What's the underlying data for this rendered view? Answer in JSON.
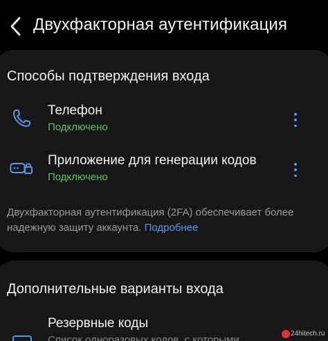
{
  "header": {
    "title": "Двухфакторная аутентификация",
    "back_icon": "chevron-left-icon"
  },
  "section1": {
    "title": "Способы подтверждения входа",
    "items": [
      {
        "icon": "phone-icon",
        "title": "Телефон",
        "status": "Подключено",
        "menu_icon": "more-vertical-icon"
      },
      {
        "icon": "authenticator-app-icon",
        "title": "Приложение для генерации кодов",
        "status": "Подключено",
        "menu_icon": "more-vertical-icon"
      }
    ],
    "description": "Двухфакторная аутентификация (2FA) обеспечивает более надежную защиту аккаунта.",
    "more_link": "Подробнее"
  },
  "section2": {
    "title": "Дополнительные варианты входа",
    "items": [
      {
        "icon": "backup-codes-icon",
        "title": "Резервные коды",
        "subtitle": "Список одноразовых кодов, с которыми"
      }
    ]
  },
  "watermark": "24hitech.ru",
  "colors": {
    "background": "#000000",
    "card": "#17171a",
    "accent": "#5b97ea",
    "success": "#5bc45a",
    "secondary_text": "#9a9a9f"
  }
}
